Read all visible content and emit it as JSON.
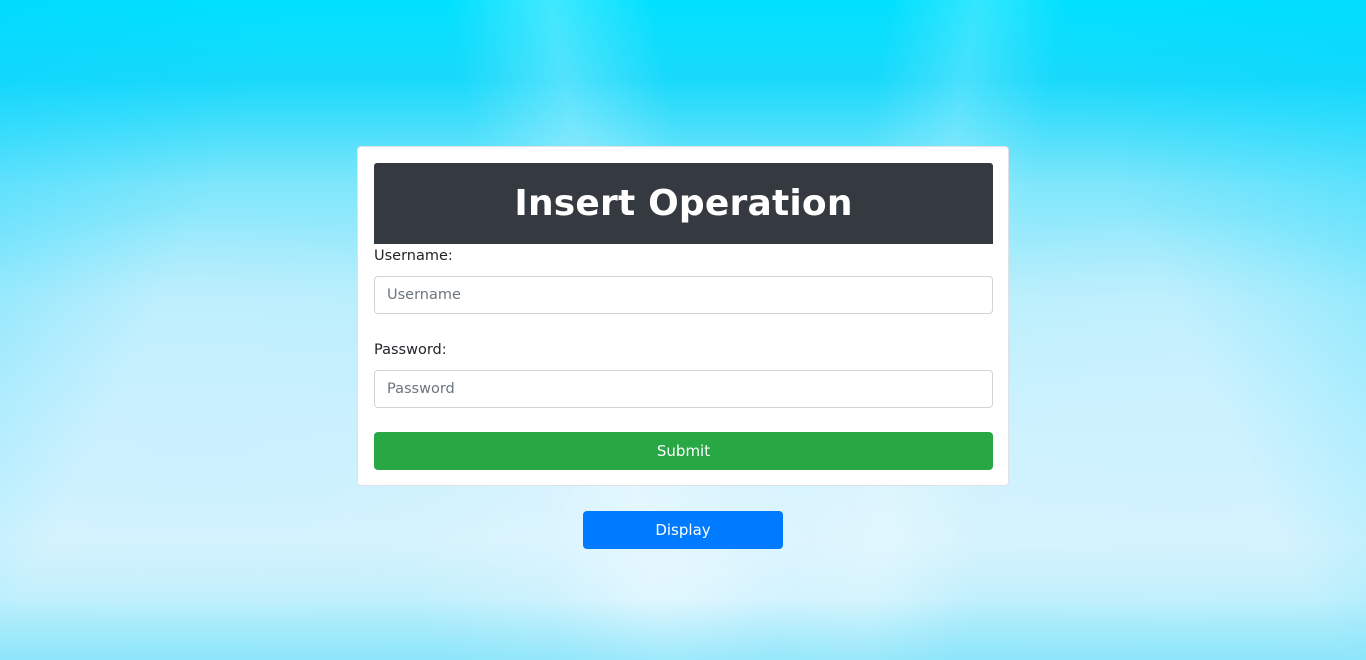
{
  "form": {
    "title": "Insert Operation",
    "username_label": "Username:",
    "username_placeholder": "Username",
    "username_value": "",
    "password_label": "Password:",
    "password_placeholder": "Password",
    "password_value": "",
    "submit_label": "Submit"
  },
  "display_button": {
    "label": "Display"
  },
  "colors": {
    "header_bg": "#343a40",
    "submit_bg": "#28a745",
    "display_bg": "#007bff",
    "background_top": "#00e1ff",
    "background_bottom": "#d6f3fd"
  }
}
